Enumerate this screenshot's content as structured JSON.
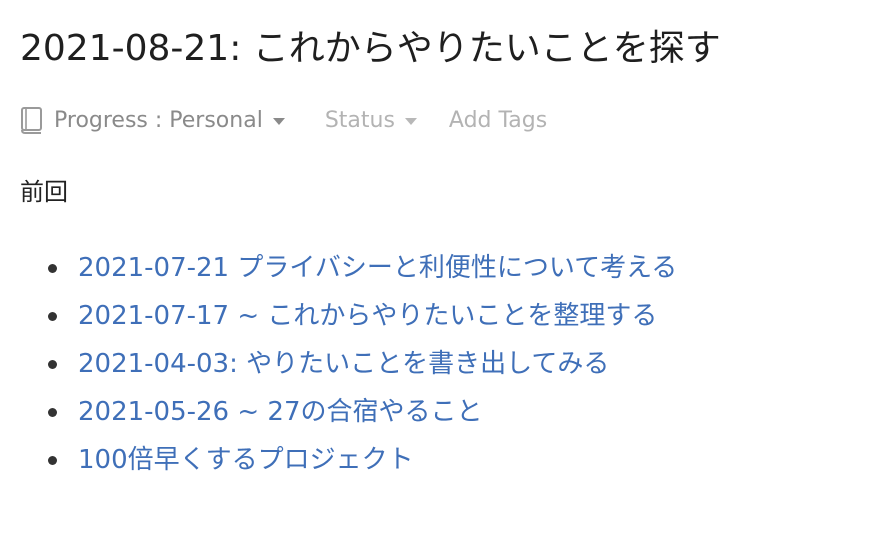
{
  "page": {
    "title": "2021-08-21: これからやりたいことを探す"
  },
  "meta": {
    "progress_label": "Progress : Personal",
    "status_label": "Status",
    "tags_label": "Add Tags"
  },
  "content": {
    "section_label": "前回",
    "links": [
      {
        "label": "2021-07-21 プライバシーと利便性について考える"
      },
      {
        "label": "2021-07-17 ~ これからやりたいことを整理する"
      },
      {
        "label": "2021-04-03: やりたいことを書き出してみる"
      },
      {
        "label": "2021-05-26 ~ 27の合宿やること"
      },
      {
        "label": "100倍早くするプロジェクト"
      }
    ]
  },
  "colors": {
    "link": "#3f6fb8",
    "muted": "#8a8a8a",
    "light": "#b3b3b3",
    "text": "#222222"
  },
  "icons": {
    "progress": "book-icon",
    "dropdown": "caret-down-icon",
    "bullet": "bullet-icon"
  }
}
